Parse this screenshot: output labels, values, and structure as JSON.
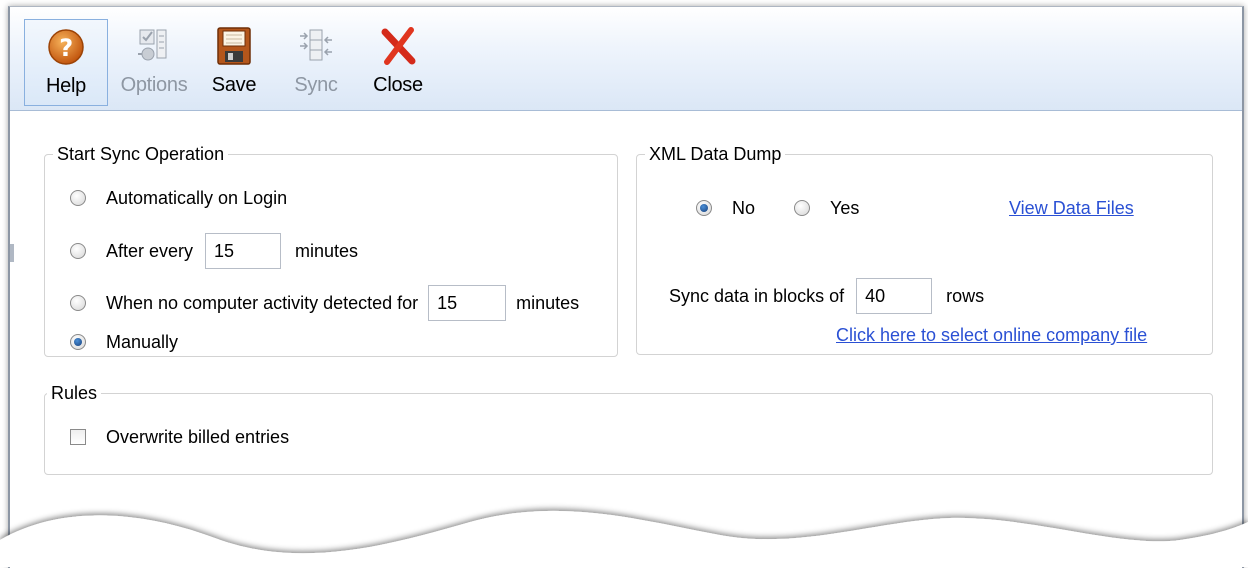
{
  "toolbar": {
    "help_label": "Help",
    "options_label": "Options",
    "save_label": "Save",
    "sync_label": "Sync",
    "close_label": "Close"
  },
  "start_sync": {
    "title": "Start Sync Operation",
    "option_auto_login": "Automatically on Login",
    "option_after_every": "After every",
    "after_every_value": "15",
    "after_every_unit": "minutes",
    "option_no_activity": "When no computer activity detected for",
    "no_activity_value": "15",
    "no_activity_unit": "minutes",
    "option_manually": "Manually",
    "selected": "Manually"
  },
  "xml_dump": {
    "title": "XML Data Dump",
    "option_no": "No",
    "option_yes": "Yes",
    "selected": "No",
    "view_files_link": "View Data Files",
    "blocks_label": "Sync data in blocks of",
    "blocks_value": "40",
    "blocks_unit": "rows",
    "select_company_link": "Click here to select online company file"
  },
  "rules": {
    "title": "Rules",
    "overwrite_billed_label": "Overwrite billed entries",
    "overwrite_billed_checked": false
  },
  "colors": {
    "toolbar_gradient_bottom": "#dbe7f6",
    "link": "#2a50d4",
    "help_icon": "#d9731c",
    "close_icon": "#d42a1a"
  }
}
